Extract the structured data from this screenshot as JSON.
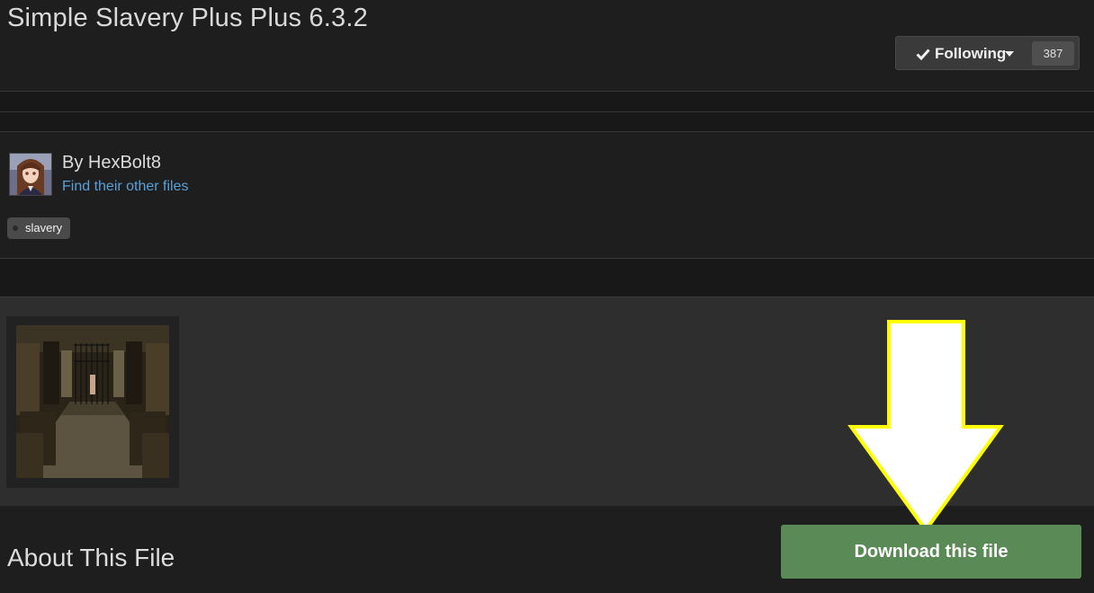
{
  "header": {
    "title": "Simple Slavery Plus Plus 6.3.2",
    "follow_label": "Following",
    "follow_count": "387"
  },
  "author": {
    "byline": "By HexBolt8",
    "other_files_link": "Find their other files"
  },
  "tags": [
    "slavery"
  ],
  "main": {
    "about_heading": "About This File",
    "download_label": "Download this file"
  },
  "colors": {
    "background": "#1e1e1e",
    "download_green": "#5a8a55",
    "link_blue": "#5aa0d8",
    "annotation_arrow": "#ffff00"
  },
  "icons": {
    "follow": "check-icon",
    "follow_menu": "caret-down-icon",
    "tag": "tag-icon",
    "annotation": "down-arrow-annotation"
  }
}
